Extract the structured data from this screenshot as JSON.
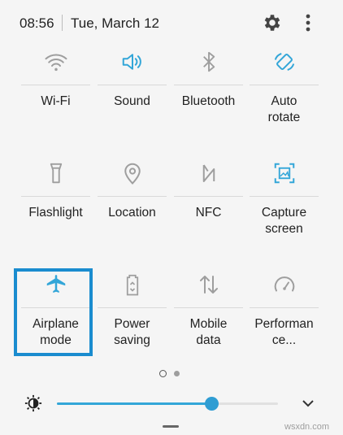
{
  "status": {
    "time": "08:56",
    "date": "Tue, March 12"
  },
  "accent": "#33a6d8",
  "tiles": [
    {
      "label": "Wi-Fi",
      "icon": "wifi-icon",
      "active": false
    },
    {
      "label": "Sound",
      "icon": "sound-icon",
      "active": true
    },
    {
      "label": "Bluetooth",
      "icon": "bluetooth-icon",
      "active": false
    },
    {
      "label": "Auto\nrotate",
      "icon": "auto-rotate-icon",
      "active": true
    },
    {
      "label": "Flashlight",
      "icon": "flashlight-icon",
      "active": false
    },
    {
      "label": "Location",
      "icon": "location-icon",
      "active": false
    },
    {
      "label": "NFC",
      "icon": "nfc-icon",
      "active": false
    },
    {
      "label": "Capture\nscreen",
      "icon": "capture-screen-icon",
      "active": true
    },
    {
      "label": "Airplane\nmode",
      "icon": "airplane-icon",
      "active": true
    },
    {
      "label": "Power\nsaving",
      "icon": "power-saving-icon",
      "active": false
    },
    {
      "label": "Mobile\ndata",
      "icon": "mobile-data-icon",
      "active": false
    },
    {
      "label": "Performan\nce...",
      "icon": "performance-icon",
      "active": false
    }
  ],
  "page_indicator": {
    "current": 1,
    "total": 2
  },
  "brightness": {
    "level": 0.7,
    "icon": "brightness-icon"
  },
  "watermark": "wsxdn.com"
}
